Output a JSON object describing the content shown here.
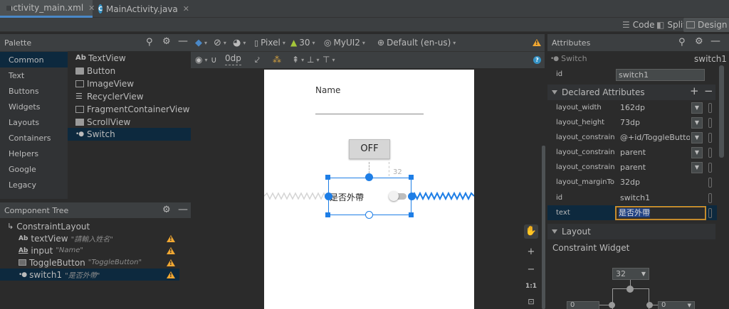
{
  "tabs": [
    {
      "label": "activity_main.xml",
      "active": true,
      "icon": "xml-file-icon"
    },
    {
      "label": "MainActivity.java",
      "active": false,
      "icon": "java-class-icon"
    }
  ],
  "modes": {
    "code": "Code",
    "split": "Split",
    "design": "Design",
    "selected": "Design"
  },
  "palette": {
    "title": "Palette",
    "categories": [
      "Common",
      "Text",
      "Buttons",
      "Widgets",
      "Layouts",
      "Containers",
      "Helpers",
      "Google",
      "Legacy"
    ],
    "selected_category": "Common",
    "widgets": [
      {
        "label": "TextView",
        "icon": "Ab"
      },
      {
        "label": "Button",
        "icon": "button-icon"
      },
      {
        "label": "ImageView",
        "icon": "image-icon"
      },
      {
        "label": "RecyclerView",
        "icon": "list-icon"
      },
      {
        "label": "FragmentContainerView",
        "icon": "fragment-icon"
      },
      {
        "label": "ScrollView",
        "icon": "scroll-icon"
      },
      {
        "label": "Switch",
        "icon": "switch-icon"
      }
    ],
    "selected_widget": "Switch"
  },
  "component_tree": {
    "title": "Component Tree",
    "root": "ConstraintLayout",
    "items": [
      {
        "type": "textView",
        "text": "\"請輸入姓名\"",
        "warning": true
      },
      {
        "type": "input",
        "text": "\"Name\"",
        "warning": true
      },
      {
        "type": "ToggleButton",
        "text": "\"ToggleButton\"",
        "warning": true
      },
      {
        "type": "switch1",
        "text": "\"是否外帶\"",
        "warning": true
      }
    ],
    "selected": "switch1"
  },
  "design_toolbar": {
    "device": "Pixel",
    "api": "30",
    "theme": "MyUI2",
    "locale": "Default (en-us)",
    "margin": "0dp"
  },
  "canvas": {
    "name_hint": "Name",
    "toggle_label": "OFF",
    "switch_text": "是否外帶",
    "margin_badge": "32",
    "zoom_fit": "1:1"
  },
  "attributes": {
    "title": "Attributes",
    "widget_type": "Switch",
    "widget_id": "switch1",
    "id_label": "id",
    "id_value": "switch1",
    "declared_title": "Declared Attributes",
    "declared": [
      {
        "name": "layout_width",
        "value": "162dp",
        "dropdown": true
      },
      {
        "name": "layout_height",
        "value": "73dp",
        "dropdown": true
      },
      {
        "name": "layout_constraint...",
        "value": "@+id/ToggleButto",
        "dropdown": true
      },
      {
        "name": "layout_constraint...",
        "value": "parent",
        "dropdown": true
      },
      {
        "name": "layout_constraint...",
        "value": "parent",
        "dropdown": true
      },
      {
        "name": "layout_marginTop",
        "value": "32dp",
        "dropdown": false
      },
      {
        "name": "id",
        "value": "switch1",
        "dropdown": false
      },
      {
        "name": "text",
        "value": "是否外帶",
        "dropdown": false,
        "editing": true
      }
    ],
    "layout_title": "Layout",
    "constraint_widget_title": "Constraint Widget",
    "cw_top": "32",
    "cw_left": "0",
    "cw_right": "0"
  },
  "colors": {
    "accent": "#4a88c7",
    "selection": "#0d293e",
    "warning": "#f0a732",
    "blueprint": "#1e7ee6"
  }
}
